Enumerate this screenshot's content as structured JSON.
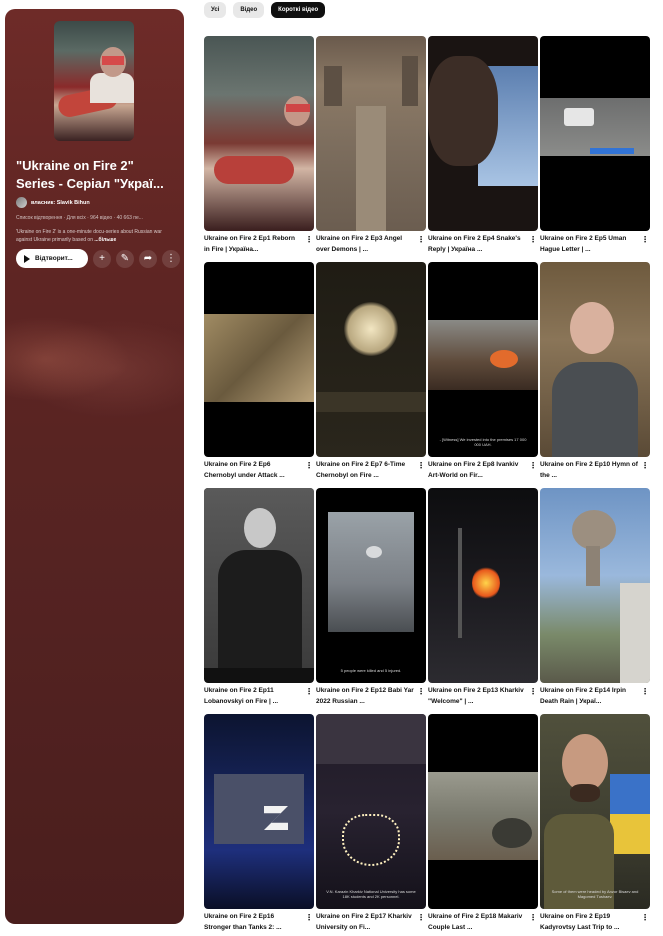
{
  "chips": [
    "Усі",
    "Відео",
    "Короткі відео"
  ],
  "active_chip": "Короткі відео",
  "playlist": {
    "title": "\"Ukraine on Fire 2\"\nSeries - Серіал \"Украї...",
    "owner": "власник: Slavik Bihun",
    "meta": "Список відтворення · Для всіх · 964 відео · 40 663 пе...",
    "description": "'Ukraine on Fire 2' is a one-minute docu-series about Russian war against Ukraine primarily based on",
    "more_label": "...більше",
    "play_label": "Відтворит...",
    "add_icon": "plus-icon",
    "edit_icon": "pencil-icon",
    "share_icon": "share-icon",
    "more_icon": "more-vert-icon"
  },
  "videos": [
    {
      "title": "Ukraine on Fire 2 Ep1 Reborn in Fire | Україна..."
    },
    {
      "title": "Ukraine on Fire 2 Ep3 Angel over Demons | ..."
    },
    {
      "title": "Ukraine on Fire 2 Ep4 Snake's Reply | Україна ..."
    },
    {
      "title": "Ukraine on Fire 2 Ep5 Uman Hague Letter | ..."
    },
    {
      "title": "Ukraine on Fire 2 Ep6 Chernobyl under Attack ..."
    },
    {
      "title": "Ukraine on Fire 2 Ep7 6-Time Chernobyl on Fire ..."
    },
    {
      "title": "Ukraine on Fire 2 Ep8 Ivankiv Art-World on Fir...",
      "caption": "- [Witness] We invested into the premises 17 000 000 UAH."
    },
    {
      "title": "Ukraine on Fire 2 Ep10 Hymn of the ..."
    },
    {
      "title": "Ukraine on Fire 2 Ep11 Lobanovskyi on Fire | ..."
    },
    {
      "title": "Ukraine on Fire 2 Ep12 Babi Yar 2022 Russian ...",
      "caption": "5 people were killed and 5 injured."
    },
    {
      "title": "Ukraine on Fire 2 Ep13 Kharkiv \"Welcome\" | ..."
    },
    {
      "title": "Ukraine on Fire 2 Ep14 Irpin Death Rain | Украї..."
    },
    {
      "title": "Ukraine on Fire 2 Ep16 Stronger than Tanks 2: ..."
    },
    {
      "title": "Ukraine on Fire 2 Ep17 Kharkiv University on Fi...",
      "caption": "V.N. Karazin Kharkiv National University has some 18K students and 2K personnel."
    },
    {
      "title": "Ukraine of Fire 2 Ep18 Makariv Couple Last ..."
    },
    {
      "title": "Ukraine on Fire 2 Ep19 Kadyrovtsy Last Trip to ...",
      "caption": "Some of them were headed by Anzor Bisaev and Magomed Tushaev."
    }
  ]
}
